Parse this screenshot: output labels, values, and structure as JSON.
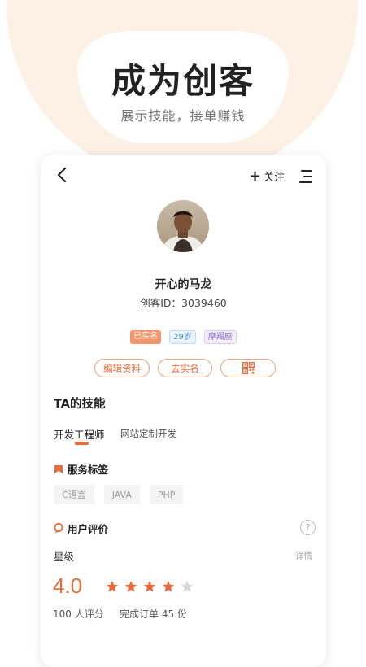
{
  "hero": {
    "title": "成为创客",
    "subtitle": "展示技能，接单赚钱"
  },
  "header": {
    "follow_label": "关注",
    "follow_prefix": "+"
  },
  "profile": {
    "name": "开心的马龙",
    "id_label": "创客ID：3039460",
    "tags": [
      "已实名",
      "29岁",
      "摩羯座"
    ],
    "actions": {
      "edit": "编辑资料",
      "verify": "去实名"
    }
  },
  "skills": {
    "title": "TA的技能",
    "tabs": [
      "开发工程师",
      "网站定制开发"
    ]
  },
  "service_tags": {
    "title": "服务标签",
    "items": [
      "C语言",
      "JAVA",
      "PHP"
    ]
  },
  "reviews": {
    "title": "用户评价",
    "help": "?",
    "star_label": "星级",
    "detail_link": "详情",
    "score": "4.0",
    "rating": 4,
    "rating_max": 5,
    "raters": "100 人评分",
    "orders": "完成订单 45 份"
  },
  "colors": {
    "accent": "#ea6b3a",
    "star_on": "#ea6b3a",
    "star_off": "#d6d6d6",
    "halo": "#fdf0e4"
  }
}
